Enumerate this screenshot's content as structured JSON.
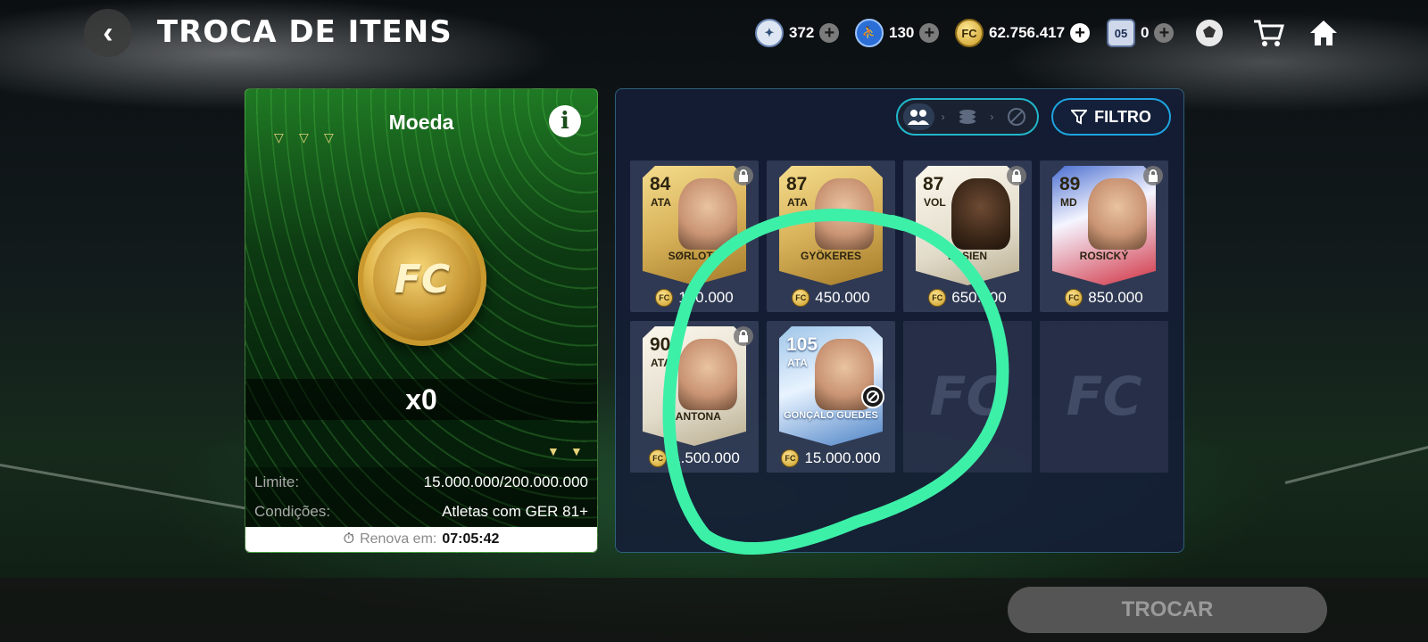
{
  "header": {
    "title": "TROCA DE ITENS",
    "back_icon": "chevron-left-icon",
    "currencies": [
      {
        "name": "skill-points",
        "value": "372"
      },
      {
        "name": "rank-tokens",
        "value": "130"
      },
      {
        "name": "coins",
        "value": "62.756.417"
      },
      {
        "name": "event-tickets",
        "value": "0",
        "badge": "05"
      }
    ]
  },
  "left_panel": {
    "title": "Moeda",
    "quantity": "x0",
    "limit_label": "Limite:",
    "limit_value": "15.000.000/200.000.000",
    "conditions_label": "Condições:",
    "conditions_value": "Atletas com GER 81+",
    "renew_label": "Renova em:",
    "renew_time": "07:05:42"
  },
  "right_panel": {
    "filter_label": "FILTRO",
    "cards": [
      {
        "rating": "84",
        "position": "ATA",
        "name": "SØRLOTH",
        "price": "100.000",
        "locked": true,
        "style": "gold"
      },
      {
        "rating": "87",
        "position": "ATA",
        "name": "GYÖKERES",
        "price": "450.000",
        "locked": false,
        "style": "gold"
      },
      {
        "rating": "87",
        "position": "VOL",
        "name": "ESSIEN",
        "price": "650.000",
        "locked": true,
        "style": "icon"
      },
      {
        "rating": "89",
        "position": "MD",
        "name": "ROSICKÝ",
        "price": "850.000",
        "locked": true,
        "style": "special"
      },
      {
        "rating": "90",
        "position": "ATA",
        "name": "CANTONA",
        "price": "1.500.000",
        "locked": true,
        "style": "icon"
      },
      {
        "rating": "105",
        "position": "ATA",
        "name": "GONÇALO GUEDES",
        "price": "15.000.000",
        "locked": false,
        "untradeable": true,
        "style": "tots"
      }
    ]
  },
  "footer": {
    "trade_label": "TROCAR"
  },
  "colors": {
    "accent_cyan": "#22b6c9",
    "filter_blue": "#1ea3e0",
    "panel_green": "#1f7a24",
    "annotation_green": "#3cf0a8"
  }
}
